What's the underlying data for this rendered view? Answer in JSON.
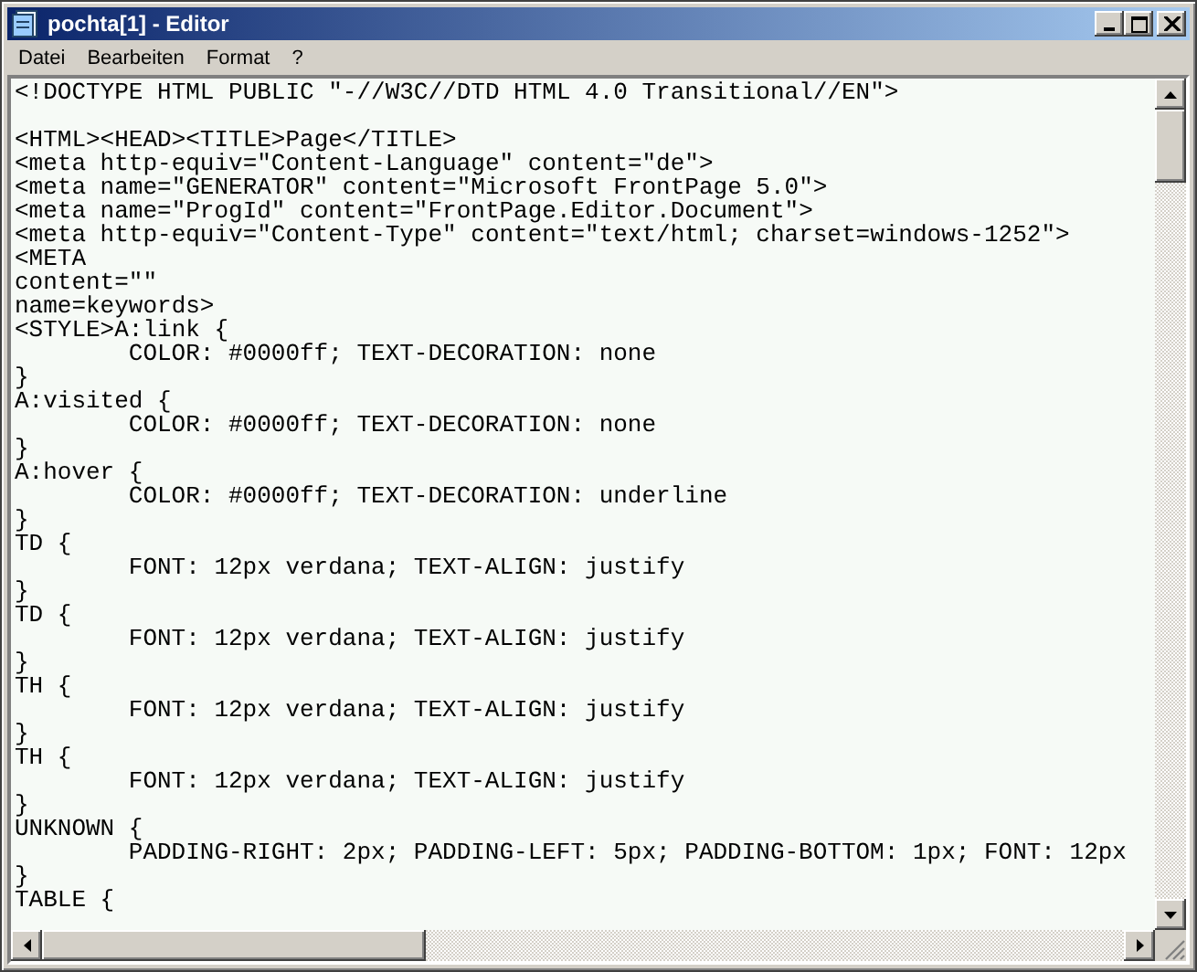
{
  "window": {
    "title": "pochta[1] - Editor"
  },
  "menu": [
    "Datei",
    "Bearbeiten",
    "Format",
    "?"
  ],
  "lines": [
    {
      "text": "<!DOCTYPE HTML PUBLIC \"-//W3C//DTD HTML 4.0 Transitional//EN\">",
      "indented": false,
      "gap_before": false
    },
    {
      "text": "<HTML><HEAD><TITLE>Page</TITLE>",
      "indented": false,
      "gap_before": true
    },
    {
      "text": "<meta http-equiv=\"Content-Language\" content=\"de\">",
      "indented": false,
      "gap_before": false
    },
    {
      "text": "<meta name=\"GENERATOR\" content=\"Microsoft FrontPage 5.0\">",
      "indented": false,
      "gap_before": false
    },
    {
      "text": "<meta name=\"ProgId\" content=\"FrontPage.Editor.Document\">",
      "indented": false,
      "gap_before": false
    },
    {
      "text": "<meta http-equiv=\"Content-Type\" content=\"text/html; charset=windows-1252\">",
      "indented": false,
      "gap_before": false
    },
    {
      "text": "<META",
      "indented": false,
      "gap_before": false
    },
    {
      "text": "content=\"\"",
      "indented": false,
      "gap_before": false
    },
    {
      "text": "name=keywords>",
      "indented": false,
      "gap_before": false
    },
    {
      "text": "<STYLE>A:link {",
      "indented": false,
      "gap_before": false
    },
    {
      "text": "COLOR: #0000ff; TEXT-DECORATION: none",
      "indented": true,
      "gap_before": false
    },
    {
      "text": "}",
      "indented": false,
      "gap_before": false
    },
    {
      "text": "A:visited {",
      "indented": false,
      "gap_before": false
    },
    {
      "text": "COLOR: #0000ff; TEXT-DECORATION: none",
      "indented": true,
      "gap_before": false
    },
    {
      "text": "}",
      "indented": false,
      "gap_before": false
    },
    {
      "text": "A:hover {",
      "indented": false,
      "gap_before": false
    },
    {
      "text": "COLOR: #0000ff; TEXT-DECORATION: underline",
      "indented": true,
      "gap_before": false
    },
    {
      "text": "}",
      "indented": false,
      "gap_before": false
    },
    {
      "text": "TD {",
      "indented": false,
      "gap_before": false
    },
    {
      "text": "FONT: 12px verdana; TEXT-ALIGN: justify",
      "indented": true,
      "gap_before": false
    },
    {
      "text": "}",
      "indented": false,
      "gap_before": false
    },
    {
      "text": "TD {",
      "indented": false,
      "gap_before": false
    },
    {
      "text": "FONT: 12px verdana; TEXT-ALIGN: justify",
      "indented": true,
      "gap_before": false
    },
    {
      "text": "}",
      "indented": false,
      "gap_before": false
    },
    {
      "text": "TH {",
      "indented": false,
      "gap_before": false
    },
    {
      "text": "FONT: 12px verdana; TEXT-ALIGN: justify",
      "indented": true,
      "gap_before": false
    },
    {
      "text": "}",
      "indented": false,
      "gap_before": false
    },
    {
      "text": "TH {",
      "indented": false,
      "gap_before": false
    },
    {
      "text": "FONT: 12px verdana; TEXT-ALIGN: justify",
      "indented": true,
      "gap_before": false
    },
    {
      "text": "}",
      "indented": false,
      "gap_before": false
    },
    {
      "text": "UNKNOWN {",
      "indented": false,
      "gap_before": false
    },
    {
      "text": "PADDING-RIGHT: 2px; PADDING-LEFT: 5px; PADDING-BOTTOM: 1px; FONT: 12px",
      "indented": true,
      "gap_before": false
    },
    {
      "text": "}",
      "indented": false,
      "gap_before": false
    },
    {
      "text": "TABLE {",
      "indented": false,
      "gap_before": false
    }
  ]
}
